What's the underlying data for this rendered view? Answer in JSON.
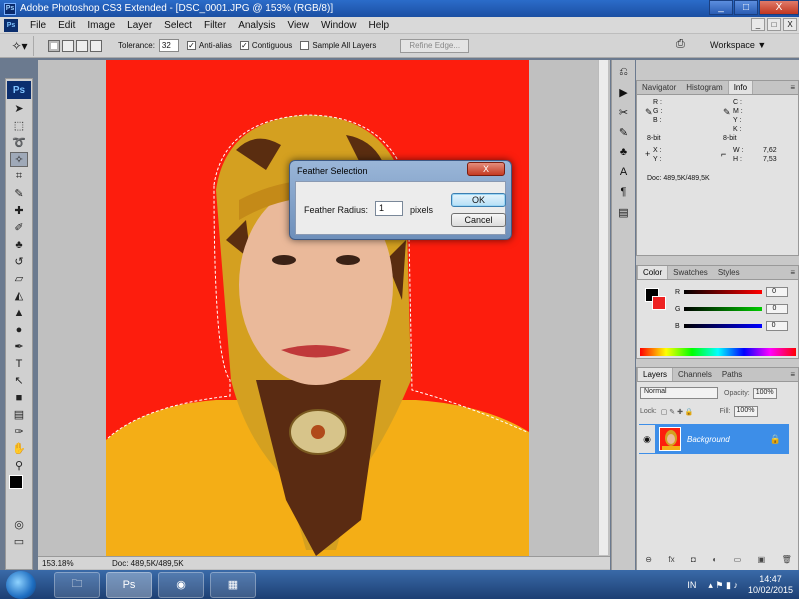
{
  "window": {
    "title": "Adobe Photoshop CS3 Extended - [DSC_0001.JPG @ 153% (RGB/8)]",
    "app_icon_text": "Ps",
    "controls": [
      "_",
      "□",
      "X"
    ]
  },
  "menubar": {
    "items": [
      "File",
      "Edit",
      "Image",
      "Layer",
      "Select",
      "Filter",
      "Analysis",
      "View",
      "Window",
      "Help"
    ],
    "doc_controls": [
      "_",
      "□",
      "X"
    ]
  },
  "options": {
    "tolerance_label": "Tolerance:",
    "tolerance_value": "32",
    "anti_alias": "Anti-alias",
    "contiguous": "Contiguous",
    "sample_all_layers": "Sample All Layers",
    "refine_edge": "Refine Edge...",
    "workspace": "Workspace ▼"
  },
  "toolbox": {
    "logo": "Ps",
    "tools": [
      "move-tool",
      "marquee-tool",
      "lasso-tool",
      "magic-wand-tool",
      "crop-tool",
      "eyedropper-tool",
      "healing-brush-tool",
      "brush-tool",
      "clone-stamp-tool",
      "history-brush-tool",
      "eraser-tool",
      "paint-bucket-tool",
      "blur-tool",
      "dodge-tool",
      "pen-tool",
      "type-tool",
      "path-selection-tool",
      "shape-tool",
      "notes-tool",
      "eyedropper-2-tool",
      "hand-tool",
      "zoom-tool"
    ]
  },
  "status": {
    "zoom": "153.18%",
    "doc": "Doc: 489,5K/489,5K"
  },
  "dialog": {
    "title": "Feather Selection",
    "close": "X",
    "radius_label": "Feather Radius:",
    "radius_value": "1",
    "unit": "pixels",
    "ok": "OK",
    "cancel": "Cancel"
  },
  "info_panel": {
    "tabs": [
      "Navigator",
      "Histogram",
      "Info"
    ],
    "active_tab": "Info",
    "r": "R :",
    "g": "G :",
    "b": "B :",
    "c": "C :",
    "m": "M :",
    "y": "Y :",
    "k": "K :",
    "bit_left": "8-bit",
    "bit_right": "8-bit",
    "x": "X :",
    "yy": "Y :",
    "w": "W :",
    "h": "H :",
    "w_value": "7,62",
    "h_value": "7,53",
    "doc": "Doc: 489,5K/489,5K"
  },
  "color_panel": {
    "tabs": [
      "Color",
      "Swatches",
      "Styles"
    ],
    "r_label": "R",
    "g_label": "G",
    "b_label": "B",
    "r_value": "0",
    "g_value": "0",
    "b_value": "0"
  },
  "layers_panel": {
    "tabs": [
      "Layers",
      "Channels",
      "Paths"
    ],
    "blend_mode": "Normal",
    "opacity_label": "Opacity:",
    "opacity_value": "100%",
    "lock_label": "Lock:",
    "fill_label": "Fill:",
    "fill_value": "100%",
    "layer_name": "Background"
  },
  "taskbar": {
    "lang": "IN",
    "time": "14:47",
    "date": "10/02/2015"
  },
  "colors": {
    "canvas_bg": "#fd1d0d",
    "selected_layer": "#3d8ee8",
    "titlebar": "#2b6cc9"
  }
}
